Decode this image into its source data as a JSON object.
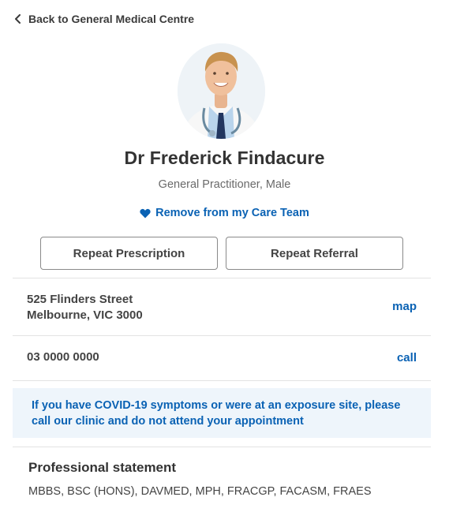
{
  "nav": {
    "back_label": "Back to General Medical Centre"
  },
  "profile": {
    "name": "Dr Frederick Findacure",
    "role": "General Practitioner, Male",
    "care_team_label": "Remove from my Care Team"
  },
  "actions": {
    "repeat_prescription_label": "Repeat Prescription",
    "repeat_referral_label": "Repeat Referral"
  },
  "contact": {
    "address_line1": "525 Flinders Street",
    "address_line2": "Melbourne, VIC 3000",
    "map_label": "map",
    "phone": "03 0000 0000",
    "call_label": "call"
  },
  "notice": {
    "text": "If you have COVID-19 symptoms or were at an exposure site, please call our clinic and do not attend your appointment"
  },
  "statement": {
    "heading": "Professional statement",
    "body": "MBBS, BSC (HONS), DAVMED, MPH, FRACGP, FACASM, FRAES"
  },
  "colors": {
    "accent": "#0a62b4",
    "notice_background": "#eef5fb",
    "text": "#333333"
  }
}
